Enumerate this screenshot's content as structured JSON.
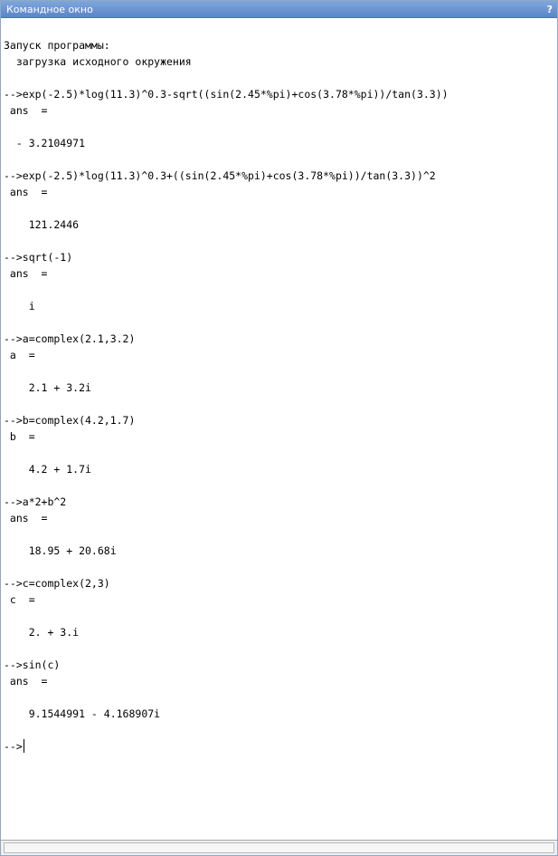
{
  "window": {
    "title": "Командное окно",
    "help_label": "?"
  },
  "console": {
    "startup": [
      "Запуск программы:",
      "  загрузка исходного окружения"
    ],
    "lines": [
      "Запуск программы:",
      "  загрузка исходного окружения",
      "",
      "-->exp(-2.5)*log(11.3)^0.3-sqrt((sin(2.45*%pi)+cos(3.78*%pi))/tan(3.3))",
      " ans  =",
      "",
      "  - 3.2104971",
      "",
      "-->exp(-2.5)*log(11.3)^0.3+((sin(2.45*%pi)+cos(3.78*%pi))/tan(3.3))^2",
      " ans  =",
      "",
      "    121.2446",
      "",
      "-->sqrt(-1)",
      " ans  =",
      "",
      "    i",
      "",
      "-->a=complex(2.1,3.2)",
      " a  =",
      "",
      "    2.1 + 3.2i",
      "",
      "-->b=complex(4.2,1.7)",
      " b  =",
      "",
      "    4.2 + 1.7i",
      "",
      "-->a*2+b^2",
      " ans  =",
      "",
      "    18.95 + 20.68i",
      "",
      "-->c=complex(2,3)",
      " c  =",
      "",
      "    2. + 3.i",
      "",
      "-->sin(c)",
      " ans  =",
      "",
      "    9.1544991 - 4.168907i",
      "",
      "-->"
    ]
  }
}
